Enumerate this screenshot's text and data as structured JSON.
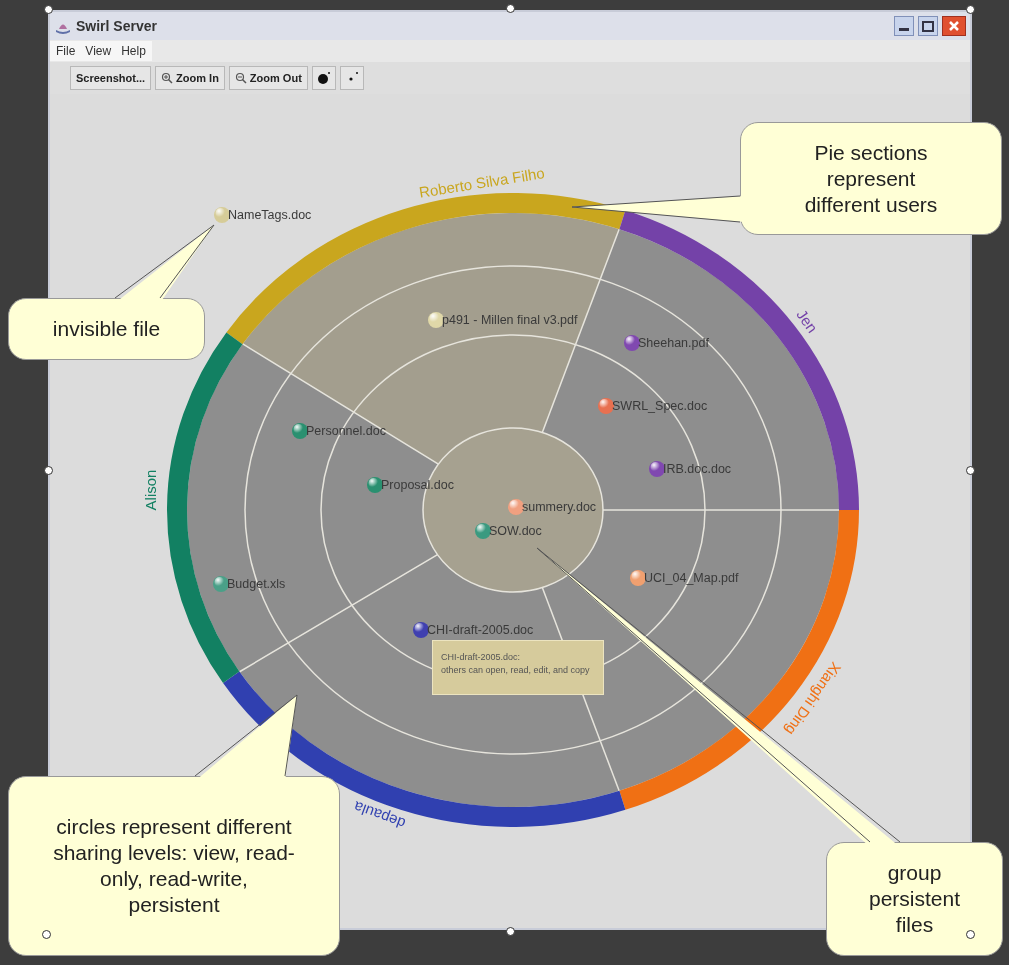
{
  "window": {
    "title": "Swirl Server"
  },
  "menu": [
    "File",
    "View",
    "Help"
  ],
  "toolbar": [
    {
      "kind": "text",
      "label": "Screenshot..."
    },
    {
      "kind": "zoom_in",
      "label": "Zoom In"
    },
    {
      "kind": "zoom_out",
      "label": "Zoom Out"
    },
    {
      "kind": "big_dot"
    },
    {
      "kind": "small_dot"
    }
  ],
  "users": [
    {
      "name": "Roberto Silva Filho",
      "color": "#c9a61e",
      "selected": true
    },
    {
      "name": "Jen",
      "color": "#7442a8",
      "selected": false
    },
    {
      "name": "Xianghi Ding",
      "color": "#f07014",
      "selected": false
    },
    {
      "name": "depaula",
      "color": "#3040b0",
      "selected": false
    },
    {
      "name": "Alison",
      "color": "#128062",
      "selected": false
    }
  ],
  "files": [
    {
      "name": "NameTags.doc",
      "color": "#d6cc98"
    },
    {
      "name": "p491 - Millen final v3.pdf",
      "color": "#e0d8a8"
    },
    {
      "name": "Sheehan.pdf",
      "color": "#8048b0"
    },
    {
      "name": "SWRL_Spec.doc",
      "color": "#e87050"
    },
    {
      "name": "Personnel.doc",
      "color": "#2a9070"
    },
    {
      "name": "IRB.doc.doc",
      "color": "#8048b0"
    },
    {
      "name": "Proposal.doc",
      "color": "#2a9070"
    },
    {
      "name": "summery.doc",
      "color": "#f0a080"
    },
    {
      "name": "SOW.doc",
      "color": "#3a9a80"
    },
    {
      "name": "UCI_04_Map.pdf",
      "color": "#f0a070"
    },
    {
      "name": "Budget.xls",
      "color": "#4aa088"
    },
    {
      "name": "CHI-draft-2005.doc",
      "color": "#4040b0"
    }
  ],
  "tooltip": {
    "title": "CHI-draft-2005.doc:",
    "text": "others can open, read, edit, and copy"
  },
  "callouts": [
    {
      "text": "Pie sections represent different users"
    },
    {
      "text": "invisible file"
    },
    {
      "text": "circles represent different sharing levels: view, read-only, read-write, persistent"
    },
    {
      "text": "group persistent files"
    }
  ]
}
